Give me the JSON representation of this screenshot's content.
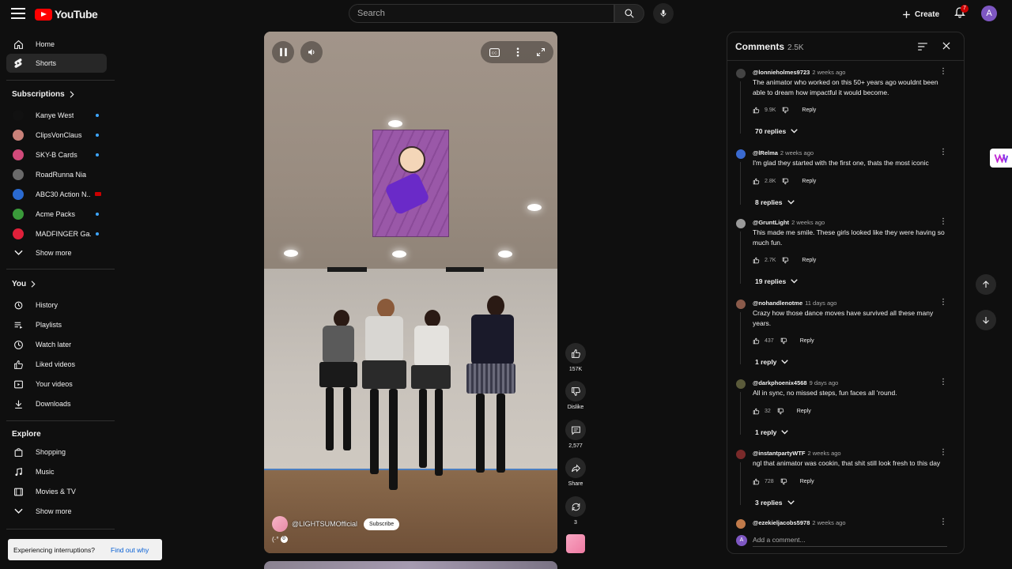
{
  "header": {
    "logo_text": "YouTube",
    "search_placeholder": "Search",
    "create_label": "Create",
    "notif_count": "7",
    "avatar_letter": "A"
  },
  "sidebar": {
    "home": "Home",
    "shorts": "Shorts",
    "subscriptions_title": "Subscriptions",
    "subscriptions": [
      {
        "name": "Kanye West",
        "color": "#111111",
        "marker": "dot"
      },
      {
        "name": "ClipsVonClaus",
        "color": "#c9827a",
        "marker": "dot"
      },
      {
        "name": "SKY-B Cards",
        "color": "#d04a7a",
        "marker": "dot"
      },
      {
        "name": "RoadRunna Nia",
        "color": "#6a6a6a",
        "marker": "none"
      },
      {
        "name": "ABC30 Action N...",
        "color": "#2a6ad0",
        "marker": "live"
      },
      {
        "name": "Acme Packs",
        "color": "#3a9a3a",
        "marker": "dot"
      },
      {
        "name": "MADFINGER Ga...",
        "color": "#e0203a",
        "marker": "dot"
      }
    ],
    "show_more_1": "Show more",
    "you_title": "You",
    "you_items": [
      "History",
      "Playlists",
      "Watch later",
      "Liked videos",
      "Your videos",
      "Downloads"
    ],
    "explore_title": "Explore",
    "explore_items": [
      "Shopping",
      "Music",
      "Movies & TV"
    ],
    "show_more_2": "Show more"
  },
  "toast": {
    "text": "Experiencing interruptions?",
    "link": "Find out why"
  },
  "video": {
    "channel": "@LIGHTSUMOfficial",
    "subscribe": "Subscribe",
    "sound_count": "0"
  },
  "actions": {
    "likes": "157K",
    "dislike": "Dislike",
    "comments": "2,577",
    "share": "Share",
    "remix": "3"
  },
  "comments_panel": {
    "title": "Comments",
    "count": "2.5K",
    "add_placeholder": "Add a comment...",
    "reply_label": "Reply",
    "items": [
      {
        "user": "@lonnieholmes9723",
        "time": "2 weeks ago",
        "text": "The animator who worked on this 50+ years ago wouldnt been able to dream how impactful it would become.",
        "likes": "9.9K",
        "replies": "70 replies",
        "avatar": "#444444"
      },
      {
        "user": "@lRelma",
        "time": "2 weeks ago",
        "text": "I'm glad they started with the first one, thats the most iconic",
        "likes": "2.8K",
        "replies": "8 replies",
        "avatar": "#3a6ad0"
      },
      {
        "user": "@GruntLight",
        "time": "2 weeks ago",
        "text": "This made me smile. These girls looked like they were having so much fun.",
        "likes": "2.7K",
        "replies": "19 replies",
        "avatar": "#9a9a9a"
      },
      {
        "user": "@nohandlenotme",
        "time": "11 days ago",
        "text": "Crazy how those dance moves have survived all these many years.",
        "likes": "437",
        "replies": "1 reply",
        "avatar": "#8a5a4a"
      },
      {
        "user": "@darkphoenix4568",
        "time": "9 days ago",
        "text": "All in sync, no missed steps, fun faces all 'round.",
        "likes": "32",
        "replies": "1 reply",
        "avatar": "#5a5a3a"
      },
      {
        "user": "@instantpartyWTF",
        "time": "2 weeks ago",
        "text": "ngl that animator was cookin, that shit still look fresh to this day",
        "likes": "728",
        "replies": "3 replies",
        "avatar": "#7a2a2a"
      },
      {
        "user": "@ezekieljacobs5978",
        "time": "2 weeks ago",
        "text": "",
        "likes": "",
        "replies": "",
        "avatar": "#c07a4a"
      }
    ]
  }
}
